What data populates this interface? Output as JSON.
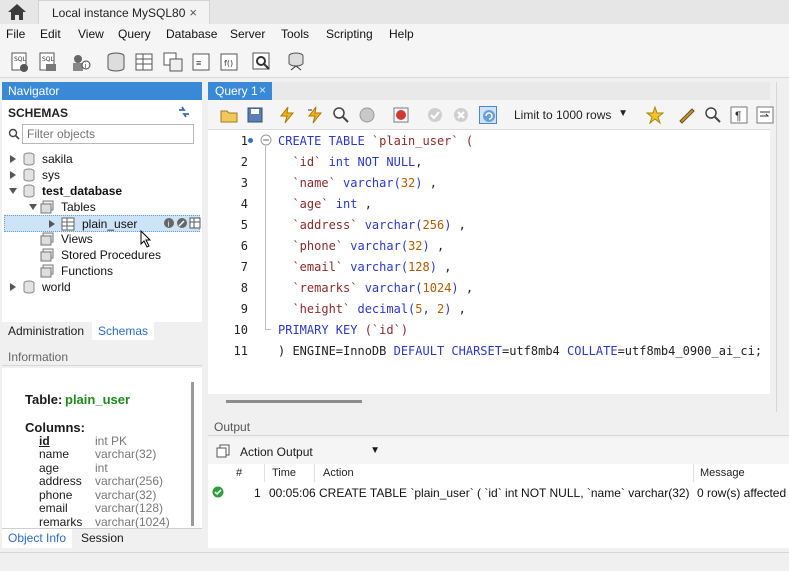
{
  "tabbar": {
    "tab_label": "Local instance MySQL80",
    "close": "×"
  },
  "menu": [
    "File",
    "Edit",
    "View",
    "Query",
    "Database",
    "Server",
    "Tools",
    "Scripting",
    "Help"
  ],
  "navigator": {
    "title": "Navigator",
    "schemas_label": "SCHEMAS",
    "filter_placeholder": "Filter objects",
    "tree": [
      {
        "label": "sakila"
      },
      {
        "label": "sys"
      },
      {
        "label": "test_database"
      },
      {
        "label": "Tables"
      },
      {
        "label": "plain_user"
      },
      {
        "label": "Views"
      },
      {
        "label": "Stored Procedures"
      },
      {
        "label": "Functions"
      },
      {
        "label": "world"
      }
    ],
    "tabs": {
      "administration": "Administration",
      "schemas": "Schemas"
    }
  },
  "information": {
    "title": "Information",
    "table_label": "Table:",
    "table_name": "plain_user",
    "columns_label": "Columns:",
    "columns": [
      {
        "name": "id",
        "type": "int PK"
      },
      {
        "name": "name",
        "type": "varchar(32)"
      },
      {
        "name": "age",
        "type": "int"
      },
      {
        "name": "address",
        "type": "varchar(256)"
      },
      {
        "name": "phone",
        "type": "varchar(32)"
      },
      {
        "name": "email",
        "type": "varchar(128)"
      },
      {
        "name": "remarks",
        "type": "varchar(1024)"
      }
    ],
    "bottom_tabs": {
      "object_info": "Object Info",
      "session": "Session"
    }
  },
  "editor": {
    "tab_label": "Query 1",
    "tab_close": "×",
    "limit_label": "Limit to 1000 rows",
    "line_numbers": [
      "1",
      "2",
      "3",
      "4",
      "5",
      "6",
      "7",
      "8",
      "9",
      "10",
      "11"
    ],
    "lines": {
      "l1a": "CREATE TABLE",
      "l1b": " `plain_user` (",
      "l2a": "  `id`",
      "l2b": " int NOT NULL",
      "l2c": ",",
      "l3a": "  `name`",
      "l3b": " varchar(",
      "l3c": "32",
      "l3d": ")",
      "l3e": " ,",
      "l4a": "  `age`",
      "l4b": " int",
      "l4c": " ,",
      "l5a": "  `address`",
      "l5b": " varchar(",
      "l5c": "256",
      "l5d": ")",
      "l5e": " ,",
      "l6a": "  `phone`",
      "l6b": " varchar(",
      "l6c": "32",
      "l6d": ")",
      "l6e": " ,",
      "l7a": "  `email`",
      "l7b": " varchar(",
      "l7c": "128",
      "l7d": ")",
      "l7e": " ,",
      "l8a": "  `remarks`",
      "l8b": " varchar(",
      "l8c": "1024",
      "l8d": ")",
      "l8e": " ,",
      "l9a": "  `height`",
      "l9b": " decimal(",
      "l9c": "5",
      "l9d": ", ",
      "l9e": "2",
      "l9f": ")",
      "l9g": " ,",
      "l10a": "PRIMARY KEY",
      "l10b": " (`id`)",
      "l11a": ") ENGINE",
      "l11b": "=InnoDB ",
      "l11c": "DEFAULT CHARSET",
      "l11d": "=utf8mb4 ",
      "l11e": "COLLATE",
      "l11f": "=utf8mb4_0900_ai_ci;"
    }
  },
  "output": {
    "title": "Output",
    "mode": "Action Output",
    "headers": {
      "num": "#",
      "time": "Time",
      "action": "Action",
      "message": "Message"
    },
    "row": {
      "num": "1",
      "time": "00:05:06",
      "action": "CREATE TABLE `plain_user` (   `id` int NOT NULL,   `name` varchar(32) ,   `...",
      "message": "0 row(s) affected"
    }
  },
  "colors": {
    "accent": "#3a89d6",
    "keyword": "#2a38c9",
    "success": "#2e9d3a"
  }
}
